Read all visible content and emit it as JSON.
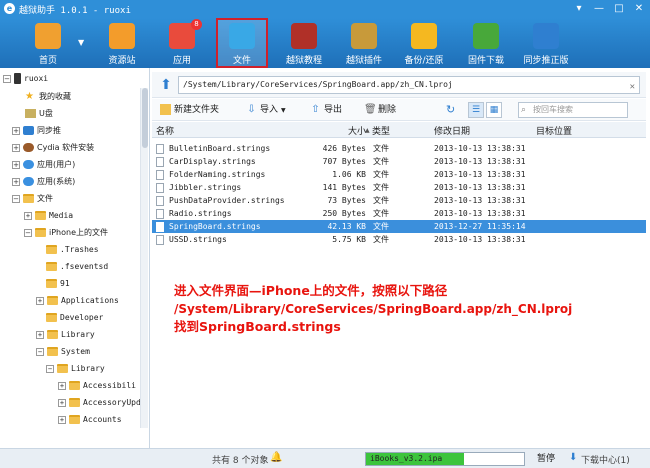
{
  "window": {
    "title": "越狱助手 1.0.1 - ruoxi"
  },
  "toolbar": {
    "items": [
      {
        "label": "首页",
        "icon": "home-icon",
        "color": "#f0a030"
      },
      {
        "label": "资源站",
        "icon": "shopping-bag-icon",
        "color": "#f39c2b"
      },
      {
        "label": "应用",
        "icon": "apps-icon",
        "color": "#e94b3c",
        "badge": "8"
      },
      {
        "label": "文件",
        "icon": "folder-sync-icon",
        "color": "#39a8e6",
        "active": true
      },
      {
        "label": "越狱教程",
        "icon": "book-icon",
        "color": "#b03028"
      },
      {
        "label": "越狱插件",
        "icon": "pineapple-icon",
        "color": "#c89a3a"
      },
      {
        "label": "备份/还原",
        "icon": "backup-icon",
        "color": "#f5b820"
      },
      {
        "label": "固件下载",
        "icon": "download-icon",
        "color": "#48a83a"
      },
      {
        "label": "同步推正版",
        "icon": "sync-push-icon",
        "color": "#2f7fd0"
      }
    ]
  },
  "sidebar": {
    "device": "ruoxi",
    "items": [
      {
        "label": "我的收藏",
        "icon": "star-icon"
      },
      {
        "label": "U盘",
        "icon": "usb-drive-icon"
      },
      {
        "label": "同步推",
        "icon": "sync-push-icon"
      },
      {
        "label": "Cydia 软件安装",
        "icon": "cydia-icon"
      },
      {
        "label": "应用(用户)",
        "icon": "apps-icon"
      },
      {
        "label": "应用(系统)",
        "icon": "apps-icon"
      },
      {
        "label": "文件",
        "icon": "folder-icon"
      },
      {
        "label": "Media",
        "icon": "folder-icon"
      },
      {
        "label": "iPhone上的文件",
        "icon": "folder-icon"
      },
      {
        "label": ".Trashes",
        "icon": "folder-icon"
      },
      {
        "label": ".fseventsd",
        "icon": "folder-icon"
      },
      {
        "label": "91",
        "icon": "folder-icon"
      },
      {
        "label": "Applications",
        "icon": "folder-icon"
      },
      {
        "label": "Developer",
        "icon": "folder-icon"
      },
      {
        "label": "Library",
        "icon": "folder-icon"
      },
      {
        "label": "System",
        "icon": "folder-icon"
      },
      {
        "label": "Library",
        "icon": "folder-icon"
      },
      {
        "label": "Accessibili",
        "icon": "folder-icon"
      },
      {
        "label": "AccessoryUpd",
        "icon": "folder-icon"
      },
      {
        "label": "Accounts",
        "icon": "folder-icon"
      }
    ]
  },
  "path": {
    "value": "/System/Library/CoreServices/SpringBoard.app/zh_CN.lproj"
  },
  "actions": {
    "new_folder": "新建文件夹",
    "import": "导入",
    "export": "导出",
    "delete": "删除",
    "search_placeholder": "按回车搜索"
  },
  "table": {
    "columns": [
      "名称",
      "大小",
      "类型",
      "修改日期",
      "目标位置"
    ],
    "rows": [
      {
        "name": "BulletinBoard.strings",
        "size": "426 Bytes",
        "type": "文件",
        "date": "2013-10-13 13:38:31",
        "target": ""
      },
      {
        "name": "CarDisplay.strings",
        "size": "707 Bytes",
        "type": "文件",
        "date": "2013-10-13 13:38:31",
        "target": ""
      },
      {
        "name": "FolderNaming.strings",
        "size": "1.06 KB",
        "type": "文件",
        "date": "2013-10-13 13:38:31",
        "target": ""
      },
      {
        "name": "Jibbler.strings",
        "size": "141 Bytes",
        "type": "文件",
        "date": "2013-10-13 13:38:31",
        "target": ""
      },
      {
        "name": "PushDataProvider.strings",
        "size": "73 Bytes",
        "type": "文件",
        "date": "2013-10-13 13:38:31",
        "target": ""
      },
      {
        "name": "Radio.strings",
        "size": "250 Bytes",
        "type": "文件",
        "date": "2013-10-13 13:38:31",
        "target": ""
      },
      {
        "name": "SpringBoard.strings",
        "size": "42.13 KB",
        "type": "文件",
        "date": "2013-12-27 11:35:14",
        "target": "",
        "selected": true
      },
      {
        "name": "USSD.strings",
        "size": "5.75 KB",
        "type": "文件",
        "date": "2013-10-13 13:38:31",
        "target": ""
      }
    ]
  },
  "annotation": {
    "line1": "进入文件界面—iPhone上的文件，按照以下路径",
    "line2": "/System/Library/CoreServices/SpringBoard.app/zh_CN.lproj",
    "line3": "找到SpringBoard.strings"
  },
  "status": {
    "count": "共有 8 个对象",
    "download_file": "iBooks_v3.2.ipa",
    "download_progress": 0.62,
    "pause": "暂停",
    "download_center": "下载中心(1)"
  },
  "colors": {
    "titlebar": "#2f8fd8",
    "selected_row": "#3b8fdc",
    "annotation": "#e8140e",
    "progress": "#3cc43c"
  }
}
